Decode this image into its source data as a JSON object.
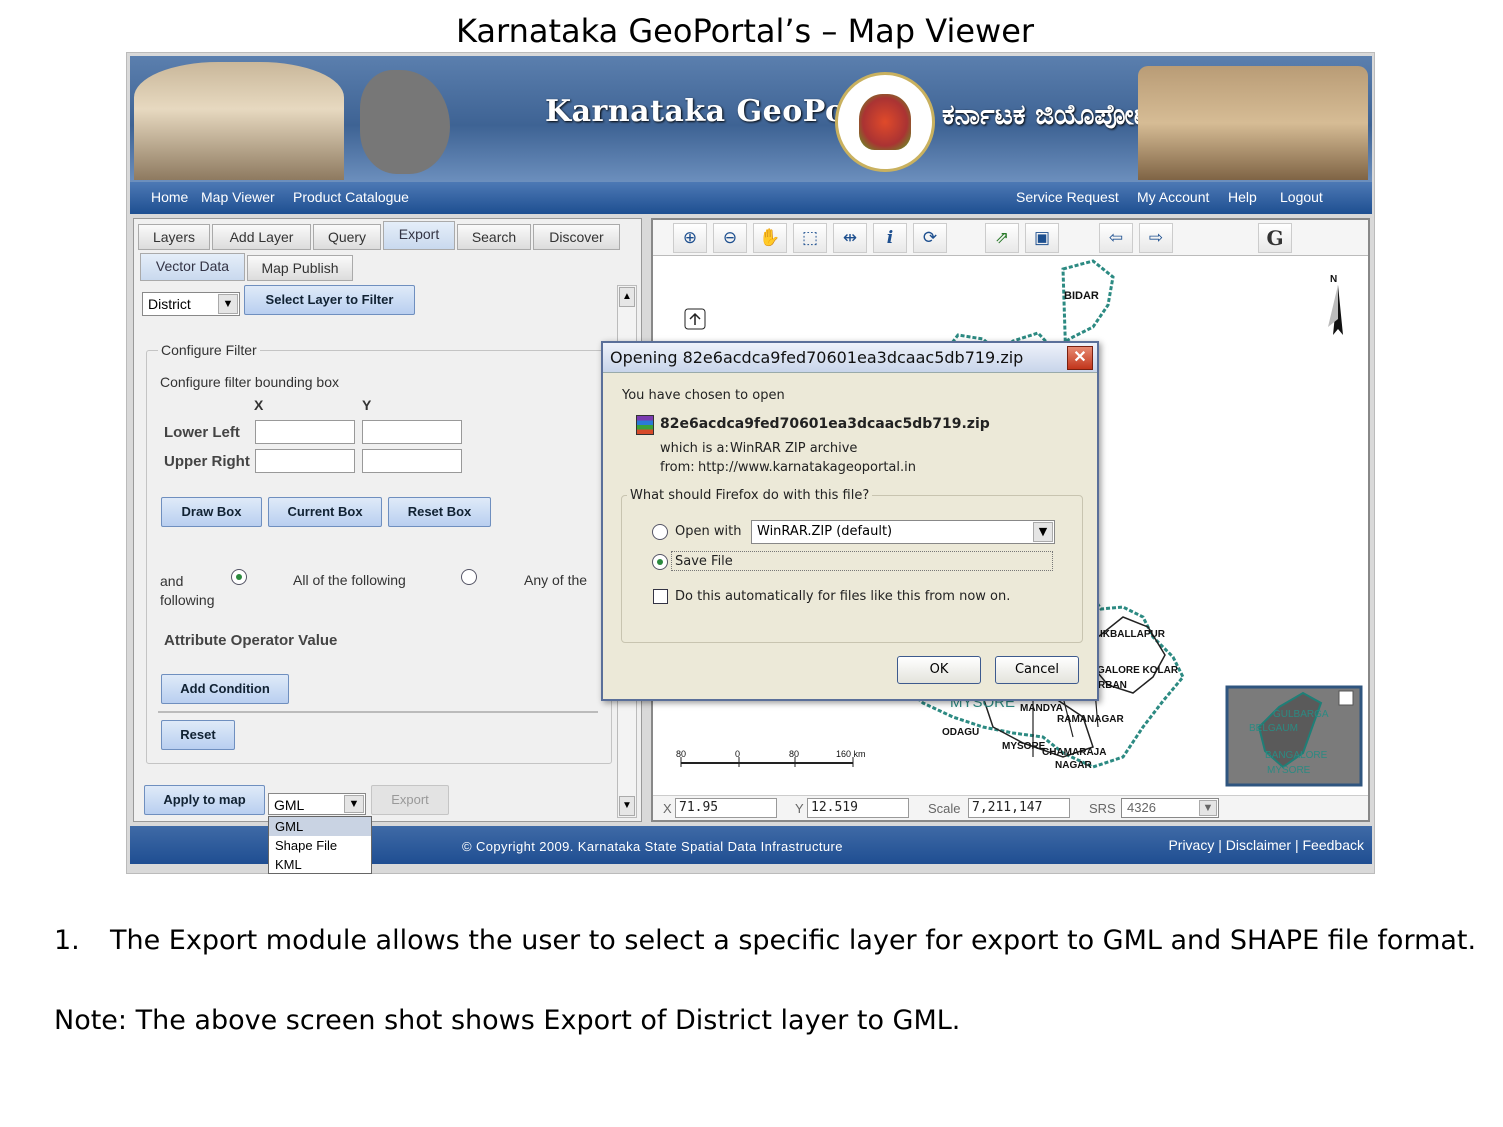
{
  "slide": {
    "title": "Karnataka GeoPortal’s – Map Viewer",
    "caption_number": "1.",
    "caption_text": "The Export module allows the user to select a specific layer for export to GML and SHAPE file format.",
    "note": "Note: The above screen shot shows Export of District layer to GML."
  },
  "banner": {
    "brand": "Karnataka GeoPortal",
    "kannada": "ಕರ್ನಾಟಕ ಜಿಯೊಪೋರ್ಟಲ್"
  },
  "nav": {
    "left": [
      "Home",
      "Map Viewer",
      "Product Catalogue"
    ],
    "right": [
      "Service Request",
      "My Account",
      "Help",
      "Logout"
    ]
  },
  "tabs": [
    "Layers",
    "Add Layer",
    "Query",
    "Export",
    "Search",
    "Discover"
  ],
  "active_tab": "Export",
  "subtabs": [
    "Vector Data",
    "Map Publish"
  ],
  "layer_select": "District",
  "select_layer_button": "Select Layer to Filter",
  "filter": {
    "legend": "Configure Filter",
    "bbox_label": "Configure filter bounding box",
    "x_label": "X",
    "y_label": "Y",
    "lower_left": "Lower Left",
    "upper_right": "Upper Right",
    "draw_box": "Draw Box",
    "current_box": "Current Box",
    "reset_box": "Reset Box",
    "and_label": "and following",
    "all_label": "All of the following",
    "any_label": "Any of the",
    "attr_header": "Attribute Operator Value",
    "add_condition": "Add Condition",
    "reset": "Reset"
  },
  "export_bar": {
    "apply": "Apply to map",
    "format": "GML",
    "export": "Export",
    "options": [
      "GML",
      "Shape File",
      "KML"
    ]
  },
  "map": {
    "labels": [
      "BIDAR",
      "IKBALLAPUR",
      "GALORE KOLAR",
      "RBAN",
      "MYSORE",
      "MANDYA",
      "RAMANAGAR",
      "ODAGU",
      "MYSORE",
      "CHAMARAJA",
      "NAGAR"
    ],
    "scale_labels": [
      "80",
      "0",
      "80",
      "160 km"
    ],
    "north": "N",
    "overview_labels": [
      "GULBARGA",
      "BELGAUM",
      "BANGALORE",
      "MYSORE"
    ],
    "status": {
      "x_label": "X",
      "x_value": "71.95",
      "y_label": "Y",
      "y_value": "12.519",
      "scale_label": "Scale",
      "scale_value": "7,211,147",
      "srs_label": "SRS",
      "srs_value": "4326"
    }
  },
  "dialog": {
    "title": "Opening 82e6acdca9fed70601ea3dcaac5db719.zip",
    "chosen": "You have chosen to open",
    "filename": "82e6acdca9fed70601ea3dcaac5db719.zip",
    "which_is_label": "which is a:",
    "which_is": "WinRAR ZIP archive",
    "from_label": "from:",
    "from": "http://www.karnatakageoportal.in",
    "question": "What should Firefox do with this file?",
    "open_with": "Open with",
    "open_with_app": "WinRAR.ZIP (default)",
    "save_file": "Save File",
    "auto": "Do this automatically for files like this from now on.",
    "ok": "OK",
    "cancel": "Cancel"
  },
  "footer": {
    "copyright": "© Copyright 2009. Karnataka State Spatial Data Infrastructure",
    "links": "Privacy | Disclaimer | Feedback"
  }
}
